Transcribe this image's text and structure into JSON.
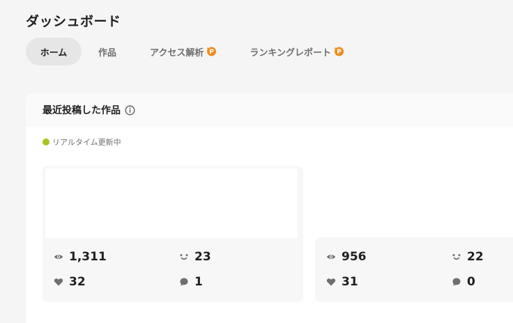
{
  "page": {
    "title": "ダッシュボード"
  },
  "tabs": [
    {
      "label": "ホーム",
      "active": true,
      "premium": false
    },
    {
      "label": "作品",
      "active": false,
      "premium": false
    },
    {
      "label": "アクセス解析",
      "active": false,
      "premium": true
    },
    {
      "label": "ランキングレポート",
      "active": false,
      "premium": true
    }
  ],
  "recent": {
    "title": "最近投稿した作品",
    "status": "リアルタイム更新中",
    "status_color": "#a8c31f",
    "works": [
      {
        "views": "1,311",
        "smiles": "23",
        "likes": "32",
        "comments": "1"
      },
      {
        "views": "956",
        "smiles": "22",
        "likes": "31",
        "comments": "0"
      }
    ]
  },
  "icons": {
    "view": "eye-icon",
    "smile": "smile-icon",
    "like": "heart-icon",
    "comment": "comment-icon",
    "info": "info-icon",
    "premium": "premium-badge-icon"
  },
  "colors": {
    "accent_orange": "#f08c1e",
    "realtime_green": "#a8c31f",
    "icon_gray": "#6f6f6f"
  }
}
